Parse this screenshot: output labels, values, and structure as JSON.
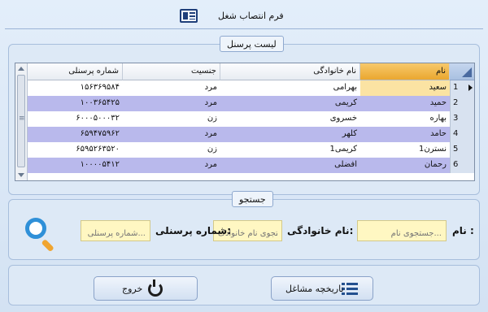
{
  "window": {
    "title": "فرم انتصاب شغل"
  },
  "list_group": {
    "legend": "لیست پرسنل"
  },
  "grid": {
    "columns": {
      "name": "نام",
      "family": "نام خانوادگی",
      "gender": "جنسیت",
      "personnel_no": "شماره پرسنلی"
    },
    "rows": [
      {
        "num": "1",
        "name": "سعید",
        "family": "بهرامی",
        "gender": "مرد",
        "personnel_no": "۱۵۶۳۶۹۵۸۴"
      },
      {
        "num": "2",
        "name": "حمید",
        "family": "کریمی",
        "gender": "مرد",
        "personnel_no": "۱۰۰۳۶۵۴۲۵"
      },
      {
        "num": "3",
        "name": "بهاره",
        "family": "خسروی",
        "gender": "زن",
        "personnel_no": "۶۰۰۰۵۰۰۰۳۲"
      },
      {
        "num": "4",
        "name": "حامد",
        "family": "کلهر",
        "gender": "مرد",
        "personnel_no": "۶۵۹۴۷۵۹۶۲"
      },
      {
        "num": "5",
        "name": "نسترن1",
        "family": "کریمی1",
        "gender": "زن",
        "personnel_no": "۶۵۹۵۲۶۳۵۲۰"
      },
      {
        "num": "6",
        "name": "رحمان",
        "family": "افضلی",
        "gender": "مرد",
        "personnel_no": "۱۰۰۰۰۵۴۱۲"
      }
    ]
  },
  "search_group": {
    "legend": "جستجو",
    "name_label": "نام :",
    "name_placeholder": "جستجوی نام...",
    "family_label": "نام خانوادگی:",
    "family_placeholder": "جستجوی نام خانوادگ...",
    "personnel_label": "شماره پرسنلی:",
    "personnel_placeholder": "شماره پرسنلی..."
  },
  "actions": {
    "history_label": "تاریخچه مشاغل",
    "exit_label": "خروج"
  },
  "colors": {
    "accent": "#eaa72f",
    "alt_row": "#b9b9ec",
    "field_bg": "#fff7c2"
  },
  "icons": [
    "newspaper-icon",
    "search-icon",
    "list-icon",
    "power-icon"
  ]
}
